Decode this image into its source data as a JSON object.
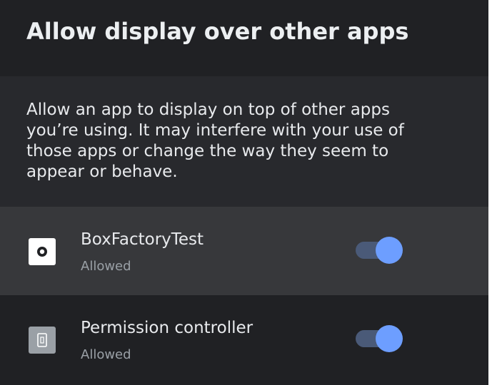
{
  "header": {
    "title": "Allow display over other apps"
  },
  "description": {
    "text": "Allow an app to display on top of other apps you’re using. It may interfere with your use of those apps or change the way they seem to appear or behave."
  },
  "apps": [
    {
      "name": "BoxFactoryTest",
      "status": "Allowed",
      "icon": "boxfactory-app-icon",
      "allowed": true,
      "highlighted": true
    },
    {
      "name": "Permission controller",
      "status": "Allowed",
      "icon": "permission-controller-app-icon",
      "allowed": true,
      "highlighted": false
    }
  ],
  "colors": {
    "background": "#202124",
    "description_background": "#28292d",
    "highlight_row": "#37383b",
    "toggle_thumb": "#6d9eff",
    "toggle_track": "#4a5a78",
    "secondary_text": "#9aa0a6"
  }
}
